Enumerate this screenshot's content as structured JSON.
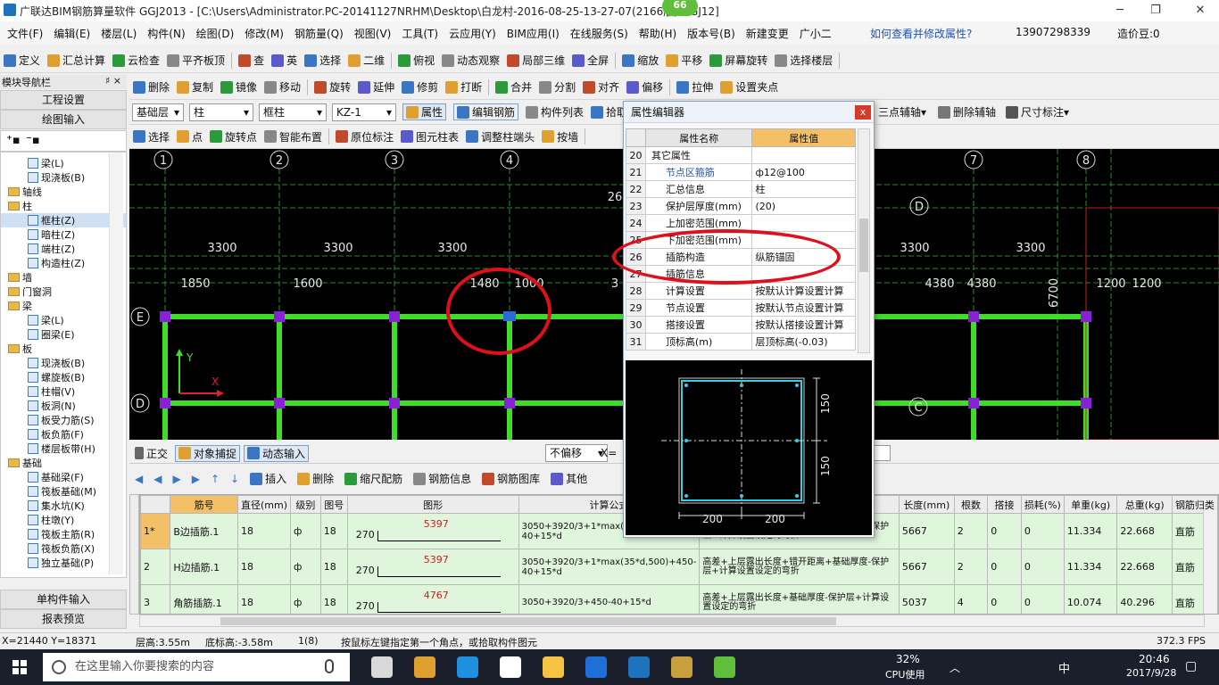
{
  "window": {
    "title": "广联达BIM钢筋算量软件 GGJ2013 - [C:\\Users\\Administrator.PC-20141127NRHM\\Desktop\\白龙村-2016-08-25-13-27-07(2166版).GGJ12]",
    "badge": "66",
    "min": "─",
    "max": "❐",
    "close": "✕"
  },
  "menu": [
    "文件(F)",
    "编辑(E)",
    "楼层(L)",
    "构件(N)",
    "绘图(D)",
    "修改(M)",
    "钢筋量(Q)",
    "视图(V)",
    "工具(T)",
    "云应用(Y)",
    "BIM应用(I)",
    "在线服务(S)",
    "帮助(H)",
    "版本号(B)",
    "新建变更",
    "广小二"
  ],
  "menu_right": {
    "link": "如何查看并修改属性?",
    "phone": "13907298339",
    "coins": "造价豆:0"
  },
  "toolbar1": [
    "定义",
    "汇总计算",
    "云检查",
    "平齐板顶",
    "查",
    "英",
    "选择",
    "二维",
    "俯视",
    "动态观察",
    "局部三维",
    "全屏",
    "缩放",
    "平移",
    "屏幕旋转",
    "选择楼层"
  ],
  "toolbar2": [
    "删除",
    "复制",
    "镜像",
    "移动",
    "旋转",
    "延伸",
    "修剪",
    "打断",
    "合并",
    "分割",
    "对齐",
    "偏移",
    "拉伸",
    "设置夹点"
  ],
  "toolbar3": {
    "floor": "基础层",
    "type": "柱",
    "sub": "框柱",
    "item": "KZ-1",
    "btns": [
      "属性",
      "编辑钢筋",
      "构件列表",
      "拾取构件"
    ],
    "right": [
      "三点辅轴",
      "删除辅轴",
      "尺寸标注"
    ]
  },
  "toolbar4": [
    "选择",
    "点",
    "旋转点",
    "智能布置",
    "原位标注",
    "图元柱表",
    "调整柱端头",
    "按墙"
  ],
  "nav": {
    "header": "模块导航栏",
    "pin": "♯ ×",
    "btn1": "工程设置",
    "btn2": "绘图输入",
    "btn3": "单构件输入",
    "btn4": "报表预览"
  },
  "tree": [
    {
      "t": "梁(L)",
      "lv": 2
    },
    {
      "t": "现浇板(B)",
      "lv": 2
    },
    {
      "t": "轴线",
      "lv": 1,
      "f": 1
    },
    {
      "t": "柱",
      "lv": 1,
      "f": 1
    },
    {
      "t": "框柱(Z)",
      "lv": 2
    },
    {
      "t": "暗柱(Z)",
      "lv": 2
    },
    {
      "t": "端柱(Z)",
      "lv": 2
    },
    {
      "t": "构造柱(Z)",
      "lv": 2
    },
    {
      "t": "墙",
      "lv": 1,
      "f": 1
    },
    {
      "t": "门窗洞",
      "lv": 1,
      "f": 1
    },
    {
      "t": "梁",
      "lv": 1,
      "f": 1
    },
    {
      "t": "梁(L)",
      "lv": 2
    },
    {
      "t": "圈梁(E)",
      "lv": 2
    },
    {
      "t": "板",
      "lv": 1,
      "f": 1
    },
    {
      "t": "现浇板(B)",
      "lv": 2
    },
    {
      "t": "螺旋板(B)",
      "lv": 2
    },
    {
      "t": "柱帽(V)",
      "lv": 2
    },
    {
      "t": "板洞(N)",
      "lv": 2
    },
    {
      "t": "板受力筋(S)",
      "lv": 2
    },
    {
      "t": "板负筋(F)",
      "lv": 2
    },
    {
      "t": "楼层板带(H)",
      "lv": 2
    },
    {
      "t": "基础",
      "lv": 1,
      "f": 1
    },
    {
      "t": "基础梁(F)",
      "lv": 2
    },
    {
      "t": "筏板基础(M)",
      "lv": 2
    },
    {
      "t": "集水坑(K)",
      "lv": 2
    },
    {
      "t": "柱墩(Y)",
      "lv": 2
    },
    {
      "t": "筏板主筋(R)",
      "lv": 2
    },
    {
      "t": "筏板负筋(X)",
      "lv": 2
    },
    {
      "t": "独立基础(P)",
      "lv": 2
    }
  ],
  "cad": {
    "axes": [
      "1",
      "2",
      "3",
      "4",
      "7",
      "8"
    ],
    "dims": [
      "3300",
      "3300",
      "3300",
      "3300",
      "3300"
    ],
    "dims2": [
      "1850",
      "1600",
      "1480",
      "1000",
      "3",
      "4380",
      "4380",
      "1200",
      "1200"
    ],
    "rows": [
      "E",
      "D",
      "D",
      "C"
    ],
    "extra": [
      "26",
      "6700"
    ],
    "ylabel": "Y",
    "xlabel": "X"
  },
  "dialog": {
    "title": "属性编辑器",
    "close": "x",
    "col1": "属性名称",
    "col2": "属性值",
    "rows": [
      {
        "n": "20",
        "name": "其它属性",
        "val": ""
      },
      {
        "n": "21",
        "name": "节点区箍筋",
        "val": "ф12@100"
      },
      {
        "n": "22",
        "name": "汇总信息",
        "val": "柱"
      },
      {
        "n": "23",
        "name": "保护层厚度(mm)",
        "val": "(20)"
      },
      {
        "n": "24",
        "name": "上加密范围(mm)",
        "val": ""
      },
      {
        "n": "25",
        "name": "下加密范围(mm)",
        "val": ""
      },
      {
        "n": "26",
        "name": "插筋构造",
        "val": "纵筋锚固"
      },
      {
        "n": "27",
        "name": "插筋信息",
        "val": ""
      },
      {
        "n": "28",
        "name": "计算设置",
        "val": "按默认计算设置计算"
      },
      {
        "n": "29",
        "name": "节点设置",
        "val": "按默认节点设置计算"
      },
      {
        "n": "30",
        "name": "搭接设置",
        "val": "按默认搭接设置计算"
      },
      {
        "n": "31",
        "name": "顶标高(m)",
        "val": "层顶标高(-0.03)"
      }
    ],
    "preview": {
      "h1": "150",
      "h2": "150",
      "w1": "200",
      "w2": "200"
    }
  },
  "btool": {
    "b1": "正交",
    "b2": "对象捕捉",
    "b3": "动态输入",
    "mode": "不偏移",
    "x": "X="
  },
  "gridtool": [
    "插入",
    "删除",
    "缩尺配筋",
    "钢筋信息",
    "钢筋图库",
    "其他"
  ],
  "grid": {
    "headers": [
      "",
      "筋号",
      "直径(mm)",
      "级别",
      "图号",
      "图形",
      "计算公式",
      "公式描述",
      "长度(mm)",
      "根数",
      "搭接",
      "损耗(%)",
      "单重(kg)",
      "总重(kg)",
      "钢筋归类"
    ],
    "rows": [
      {
        "idx": "1*",
        "name": "B边插筋.1",
        "d": "18",
        "lv": "ф",
        "fig": "18",
        "pre": "270",
        "shape": "5397",
        "formula": "3050+3920/3+1*max(35*d,500)+450-40+15*d",
        "desc": "高差+上层露出长度+错开距离+基础厚度-保护层+计算设置设定的弯折",
        "wl": "(0)",
        "len": "5667",
        "cnt": "2",
        "lap": "0",
        "loss": "0",
        "uw": "11.334",
        "tw": "22.668",
        "cls": "直筋"
      },
      {
        "idx": "2",
        "name": "H边插筋.1",
        "d": "18",
        "lv": "ф",
        "fig": "18",
        "pre": "270",
        "shape": "5397",
        "formula": "3050+3920/3+1*max(35*d,500)+450-40+15*d",
        "desc": "高差+上层露出长度+错开距离+基础厚度-保护层+计算设置设定的弯折",
        "wl": "(0)",
        "len": "5667",
        "cnt": "2",
        "lap": "0",
        "loss": "0",
        "uw": "11.334",
        "tw": "22.668",
        "cls": "直筋"
      },
      {
        "idx": "3",
        "name": "角筋插筋.1",
        "d": "18",
        "lv": "ф",
        "fig": "18",
        "pre": "270",
        "shape": "4767",
        "formula": "3050+3920/3+450-40+15*d",
        "desc": "高差+上层露出长度+基础厚度-保护层+计算设置设定的弯折",
        "wl": "(0)",
        "len": "5037",
        "cnt": "4",
        "lap": "0",
        "loss": "0",
        "uw": "10.074",
        "tw": "40.296",
        "cls": "直筋"
      }
    ]
  },
  "status": {
    "xy": "X=21440 Y=18371",
    "floorh": "层高:3.55m",
    "bottom": "底标高:-3.58m",
    "sel": "1(8)",
    "hint": "按鼠标左键指定第一个角点，或拾取构件图元",
    "fps": "372.3 FPS"
  },
  "taskbar": {
    "search": "在这里输入你要搜索的内容",
    "cpu": "32%",
    "cpulabel": "CPU使用",
    "ime": "中",
    "time": "20:46",
    "date": "2017/9/28"
  },
  "colors": {
    "axis": "#3fdc2a",
    "column": "#8a1fd8",
    "highlight": "#e0101a"
  }
}
